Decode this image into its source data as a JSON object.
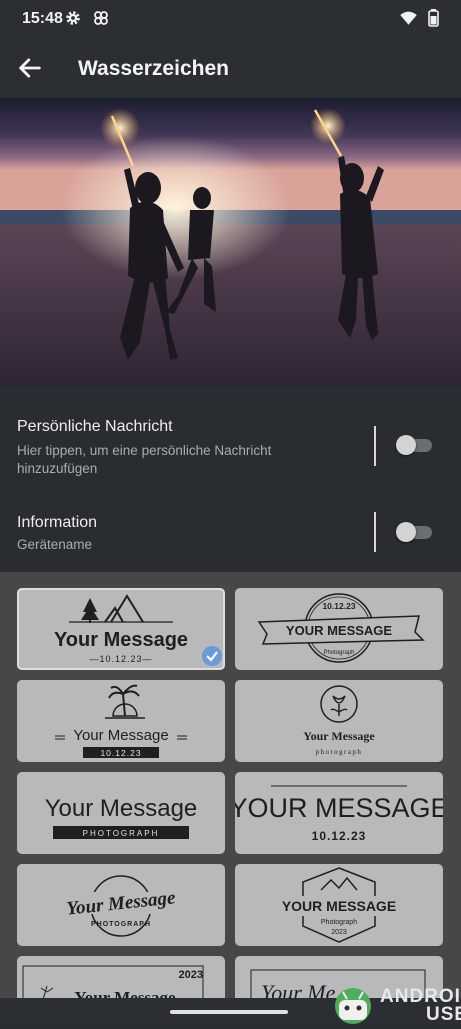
{
  "status_bar": {
    "time": "15:48",
    "left_icons": [
      "gear-icon",
      "pinwheel-icon"
    ],
    "right_icons": [
      "wifi-icon",
      "battery-icon"
    ]
  },
  "app_bar": {
    "title": "Wasserzeichen",
    "back_icon": "arrow-left-icon"
  },
  "settings": [
    {
      "title": "Persönliche Nachricht",
      "subtitle": "Hier tippen, um eine persönliche Nachricht hinzuzufügen",
      "enabled": false
    },
    {
      "title": "Information",
      "subtitle": "Gerätename",
      "enabled": false
    }
  ],
  "watermark_templates": [
    {
      "message": "Your Message",
      "line2": "—10.12.23—",
      "selected": true,
      "icons": [
        "tree-icon",
        "mountain-icon"
      ]
    },
    {
      "message": "YOUR MESSAGE",
      "line1": "10.12.23",
      "line2": "Photograph",
      "selected": false
    },
    {
      "message": "Your Message",
      "line2": "10.12.23",
      "selected": false,
      "icons": [
        "palm-tree-icon"
      ]
    },
    {
      "message": "Your Message",
      "line2": "photograph",
      "selected": false,
      "icons": [
        "tulip-icon"
      ]
    },
    {
      "message": "Your Message",
      "line2": "PHOTOGRAPH",
      "selected": false
    },
    {
      "message": "YOUR MESSAGE",
      "line2": "10.12.23",
      "selected": false
    },
    {
      "message": "Your Message",
      "line2": "PHOTOGRAPH",
      "selected": false
    },
    {
      "message": "YOUR MESSAGE",
      "line1": "Photograph",
      "line2": "2023",
      "selected": false,
      "icons": [
        "mountain-icon"
      ]
    },
    {
      "message": "Your Message",
      "line1": "2023",
      "selected": false
    },
    {
      "message": "Your Me",
      "selected": false
    }
  ],
  "corner_badge": {
    "line1": "ANDROID",
    "line2": "USER"
  },
  "colors": {
    "background": "#292c30",
    "grid_panel": "#454749",
    "tile": "#b8b9ba",
    "check": "#6a9bd8"
  }
}
